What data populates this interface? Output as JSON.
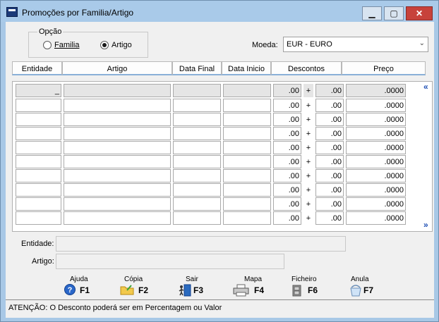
{
  "window": {
    "title": "Promoções por Familia/Artigo",
    "minimize_label": "▁",
    "maximize_label": "▢",
    "close_label": "✕"
  },
  "opcao": {
    "label": "Opção",
    "familia_label": "Familia",
    "artigo_label": "Artigo",
    "selected": "Artigo"
  },
  "moeda": {
    "label": "Moeda:",
    "value": "EUR - EURO"
  },
  "table": {
    "headers": [
      "Entidade",
      "Artigo",
      "Data Final",
      "Data Inicio",
      "Descontos",
      "Preço"
    ],
    "first_row": {
      "entidade": "_",
      "desc1": ".00",
      "plus": "+",
      "desc2": ".00",
      "preco": ".0000"
    },
    "rows": [
      {
        "desc1": ".00",
        "plus": "+",
        "desc2": ".00",
        "preco": ".0000"
      },
      {
        "desc1": ".00",
        "plus": "+",
        "desc2": ".00",
        "preco": ".0000"
      },
      {
        "desc1": ".00",
        "plus": "+",
        "desc2": ".00",
        "preco": ".0000"
      },
      {
        "desc1": ".00",
        "plus": "+",
        "desc2": ".00",
        "preco": ".0000"
      },
      {
        "desc1": ".00",
        "plus": "+",
        "desc2": ".00",
        "preco": ".0000"
      },
      {
        "desc1": ".00",
        "plus": "+",
        "desc2": ".00",
        "preco": ".0000"
      },
      {
        "desc1": ".00",
        "plus": "+",
        "desc2": ".00",
        "preco": ".0000"
      },
      {
        "desc1": ".00",
        "plus": "+",
        "desc2": ".00",
        "preco": ".0000"
      },
      {
        "desc1": ".00",
        "plus": "+",
        "desc2": ".00",
        "preco": ".0000"
      }
    ],
    "scroll_up": "«",
    "scroll_down": "»"
  },
  "fields": {
    "entidade_label": "Entidade:",
    "artigo_label": "Artigo:"
  },
  "function_keys": [
    {
      "caption": "Ajuda",
      "key": "F1",
      "icon": "help-icon"
    },
    {
      "caption": "Cópia",
      "key": "F2",
      "icon": "folder-copy-icon"
    },
    {
      "caption": "Sair",
      "key": "F3",
      "icon": "exit-door-icon"
    },
    {
      "caption": "Mapa",
      "key": "F4",
      "icon": "printer-icon"
    },
    {
      "caption": "Ficheiro",
      "key": "F6",
      "icon": "file-cabinet-icon"
    },
    {
      "caption": "Anula",
      "key": "F7",
      "icon": "undo-icon"
    }
  ],
  "status": {
    "text": "ATENÇÃO: O Desconto poderá ser em Percentagem ou Valor"
  },
  "colors": {
    "title_bar": "#a9cae9",
    "close_button": "#c7423b",
    "scroll_arrows": "#1f4fb4"
  }
}
